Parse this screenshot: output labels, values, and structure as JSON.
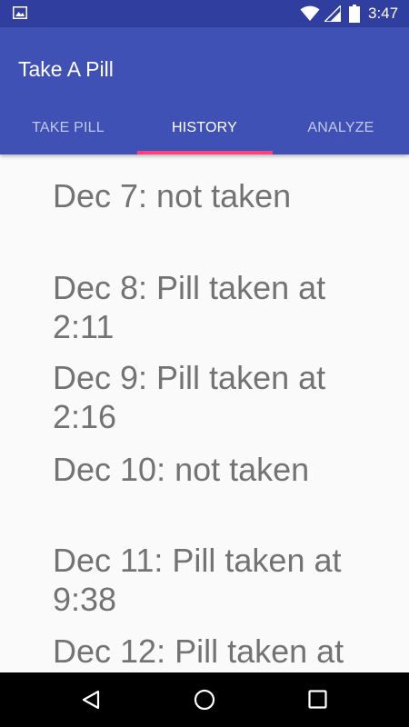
{
  "status_bar": {
    "time": "3:47",
    "icons": [
      "gallery-icon",
      "wifi-icon",
      "cell-signal-icon",
      "battery-icon"
    ]
  },
  "app": {
    "title": "Take A Pill",
    "primary_color": "#3f51b5",
    "status_color": "#303f9f",
    "accent_color": "#ff4081"
  },
  "tabs": [
    {
      "label": "TAKE PILL",
      "active": false
    },
    {
      "label": "HISTORY",
      "active": true
    },
    {
      "label": "ANALYZE",
      "active": false
    }
  ],
  "history": [
    {
      "text": "Dec 7: not taken"
    },
    {
      "text": "Dec 8: Pill taken at 2:11"
    },
    {
      "text": "Dec 9: Pill taken at 2:16"
    },
    {
      "text": "Dec 10: not taken"
    },
    {
      "text": "Dec 11: Pill taken at 9:38"
    },
    {
      "text": "Dec 12: Pill taken at"
    }
  ],
  "nav_bar": {
    "icons": [
      "back-icon",
      "home-icon",
      "recents-icon"
    ]
  }
}
